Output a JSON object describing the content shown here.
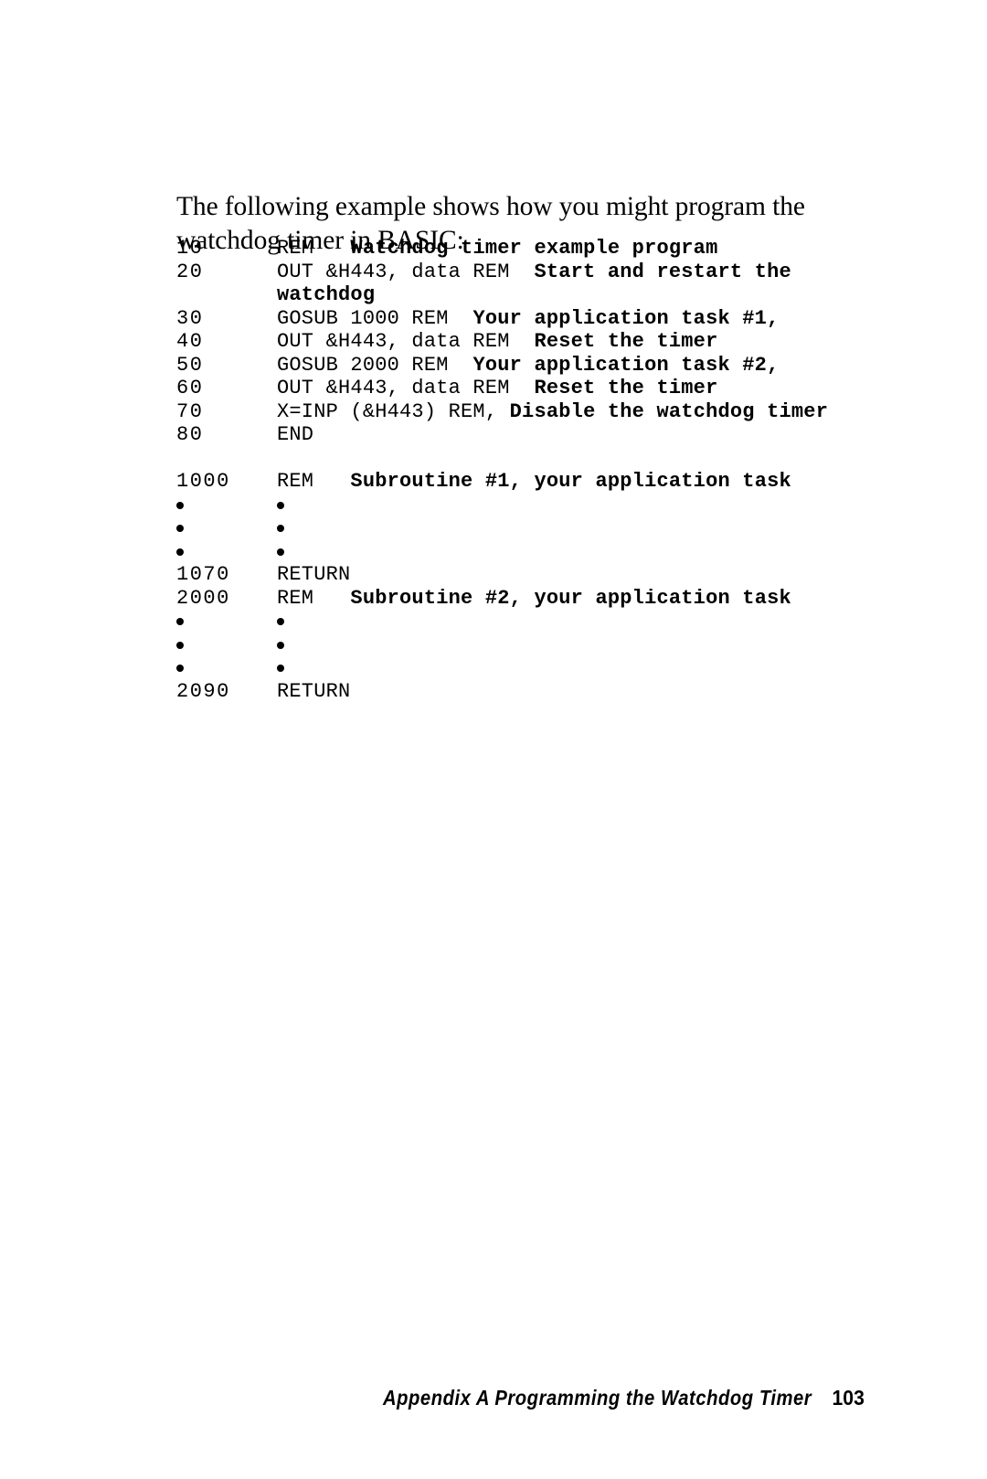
{
  "intro": {
    "text": "The following example shows how you might program the watchdog timer in BASIC:"
  },
  "listing": {
    "rows": [
      {
        "type": "code",
        "line": "10",
        "code_plain": "REM   ",
        "code_comment": "Watchdog timer example program"
      },
      {
        "type": "code",
        "line": "20",
        "code_plain": "OUT &H443, data REM  ",
        "code_comment": "Start and restart the"
      },
      {
        "type": "code",
        "line": "",
        "code_plain": "",
        "code_comment": "watchdog"
      },
      {
        "type": "code",
        "line": "30",
        "code_plain": "GOSUB 1000 REM  ",
        "code_comment": "Your application task #1,"
      },
      {
        "type": "code",
        "line": "40",
        "code_plain": "OUT &H443, data REM  ",
        "code_comment": "Reset the timer"
      },
      {
        "type": "code",
        "line": "50",
        "code_plain": "GOSUB 2000 REM  ",
        "code_comment": "Your application task #2,"
      },
      {
        "type": "code",
        "line": "60",
        "code_plain": "OUT &H443, data REM  ",
        "code_comment": "Reset the timer"
      },
      {
        "type": "code",
        "line": "70",
        "code_plain": "X=INP (&H443) REM, ",
        "code_comment": "Disable the watchdog timer"
      },
      {
        "type": "code",
        "line": "80",
        "code_plain": "END",
        "code_comment": ""
      },
      {
        "type": "spacer"
      },
      {
        "type": "code",
        "line": "1000",
        "code_plain": "REM   ",
        "code_comment": "Subroutine #1, your application task"
      },
      {
        "type": "bullet"
      },
      {
        "type": "bullet"
      },
      {
        "type": "bullet"
      },
      {
        "type": "code",
        "line": "1070",
        "code_plain": "RETURN",
        "code_comment": ""
      },
      {
        "type": "code",
        "line": "2000",
        "code_plain": "REM   ",
        "code_comment": "Subroutine #2, your application task"
      },
      {
        "type": "bullet"
      },
      {
        "type": "bullet"
      },
      {
        "type": "bullet"
      },
      {
        "type": "code",
        "line": "2090",
        "code_plain": "RETURN",
        "code_comment": ""
      }
    ]
  },
  "footer": {
    "label": "Appendix A  Programming the Watchdog Timer",
    "page_number": "103"
  }
}
